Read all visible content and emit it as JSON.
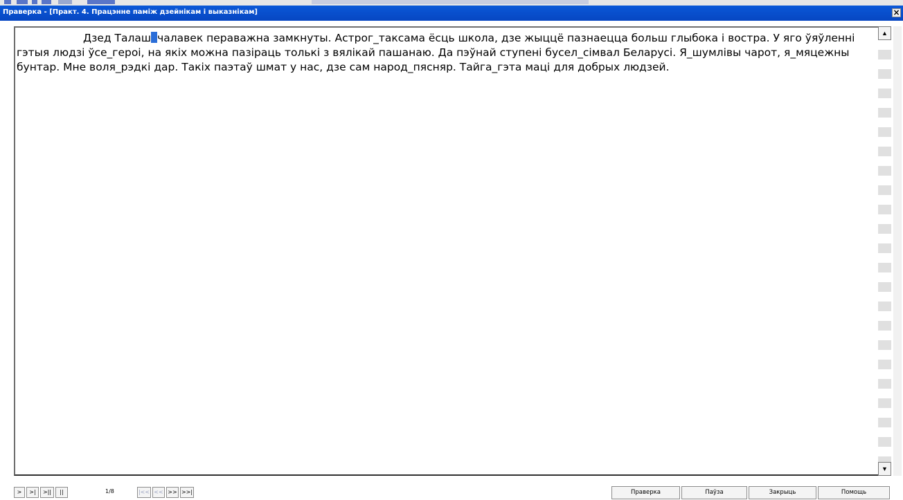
{
  "window": {
    "title": "Праверка - [Практ. 4. Працэнне паміж дзейнікам і выказнікам]",
    "close_label": "×"
  },
  "document": {
    "text_parts": {
      "before_caret": "Дзед Талаш",
      "after_caret": "чалавек пераважна замкнуты. Астрог_таксама ёсць школа, дзе жыццё пазнаецца больш глыбока і востра. У яго ўяўленні гэтыя людзі ўсе_героі, на якіх можна пазіраць толькі з вялікай пашанаю. Да пэўнай ступені бусел_сімвал Беларусі. Я_шумлівы чарот, я_мяцежны бунтар. Мне воля_рэдкі дар. Такіх паэтаў шмат у нас, дзе сам народ_пясняр. Тайга_гэта маці для добрых людзей."
    }
  },
  "scrollbar": {
    "up_arrow": "▲",
    "down_arrow": "▼"
  },
  "transport": {
    "play": ">",
    "play_to_end": ">|",
    "play_segment": ">||",
    "pause": "||",
    "counter": "1/8",
    "first": "|<<",
    "prev": "<<",
    "next": ">>",
    "last": ">>|"
  },
  "actions": {
    "check": "Праверка",
    "pause": "Паўза",
    "close": "Закрыць",
    "help": "Помощь"
  },
  "colors": {
    "titlebar": "#0b58d8",
    "caret": "#2b6ed8"
  }
}
